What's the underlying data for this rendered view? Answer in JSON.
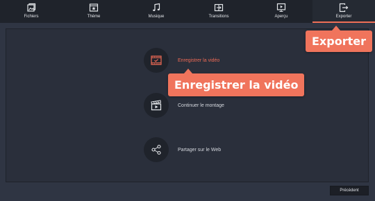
{
  "nav": {
    "tabs": [
      {
        "label": "Fichiers",
        "icon": "files-icon"
      },
      {
        "label": "Thème",
        "icon": "theme-icon"
      },
      {
        "label": "Musique",
        "icon": "music-icon"
      },
      {
        "label": "Transitions",
        "icon": "transitions-icon"
      },
      {
        "label": "Aperçu",
        "icon": "preview-icon"
      },
      {
        "label": "Exporter",
        "icon": "export-icon",
        "active": true
      }
    ]
  },
  "options": {
    "save": {
      "label": "Enregistrer la vidéo",
      "icon": "film-check-icon"
    },
    "continue": {
      "label": "Continuer le montage",
      "icon": "clapperboard-icon"
    },
    "share": {
      "label": "Partager sur le Web",
      "icon": "share-icon"
    }
  },
  "callouts": {
    "export": "Exporter",
    "save": "Enregistrer la vidéo"
  },
  "footer": {
    "previous_label": "Précédent"
  },
  "colors": {
    "accent": "#f0745c",
    "topbar": "#1f232b",
    "background": "#2f3543",
    "panel": "#2a2f3b"
  }
}
